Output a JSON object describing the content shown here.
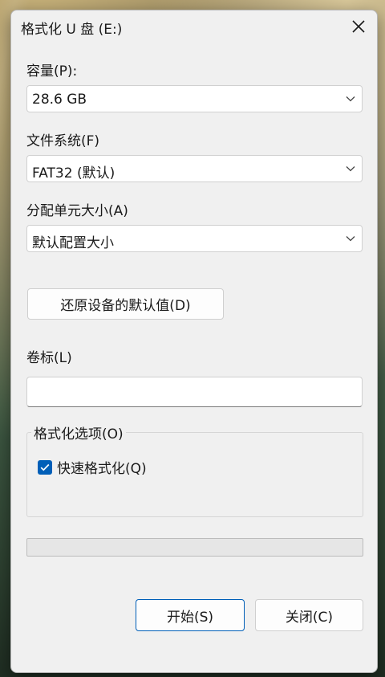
{
  "window": {
    "title": "格式化 U 盘 (E:)",
    "close_icon": "close-icon"
  },
  "capacity": {
    "label": "容量(P):",
    "value": "28.6 GB"
  },
  "file_system": {
    "label": "文件系统(F)",
    "value": "FAT32 (默认)"
  },
  "allocation_unit": {
    "label": "分配单元大小(A)",
    "value": "默认配置大小"
  },
  "restore_defaults_button": "还原设备的默认值(D)",
  "volume_label": {
    "label": "卷标(L)",
    "value": ""
  },
  "format_options": {
    "legend": "格式化选项(O)",
    "quick_format": {
      "label": "快速格式化(Q)",
      "checked": true
    }
  },
  "progress": {
    "value": 0
  },
  "buttons": {
    "start": "开始(S)",
    "close": "关闭(C)"
  },
  "colors": {
    "accent": "#005fb8",
    "dialog_bg": "#f0f0f0"
  }
}
